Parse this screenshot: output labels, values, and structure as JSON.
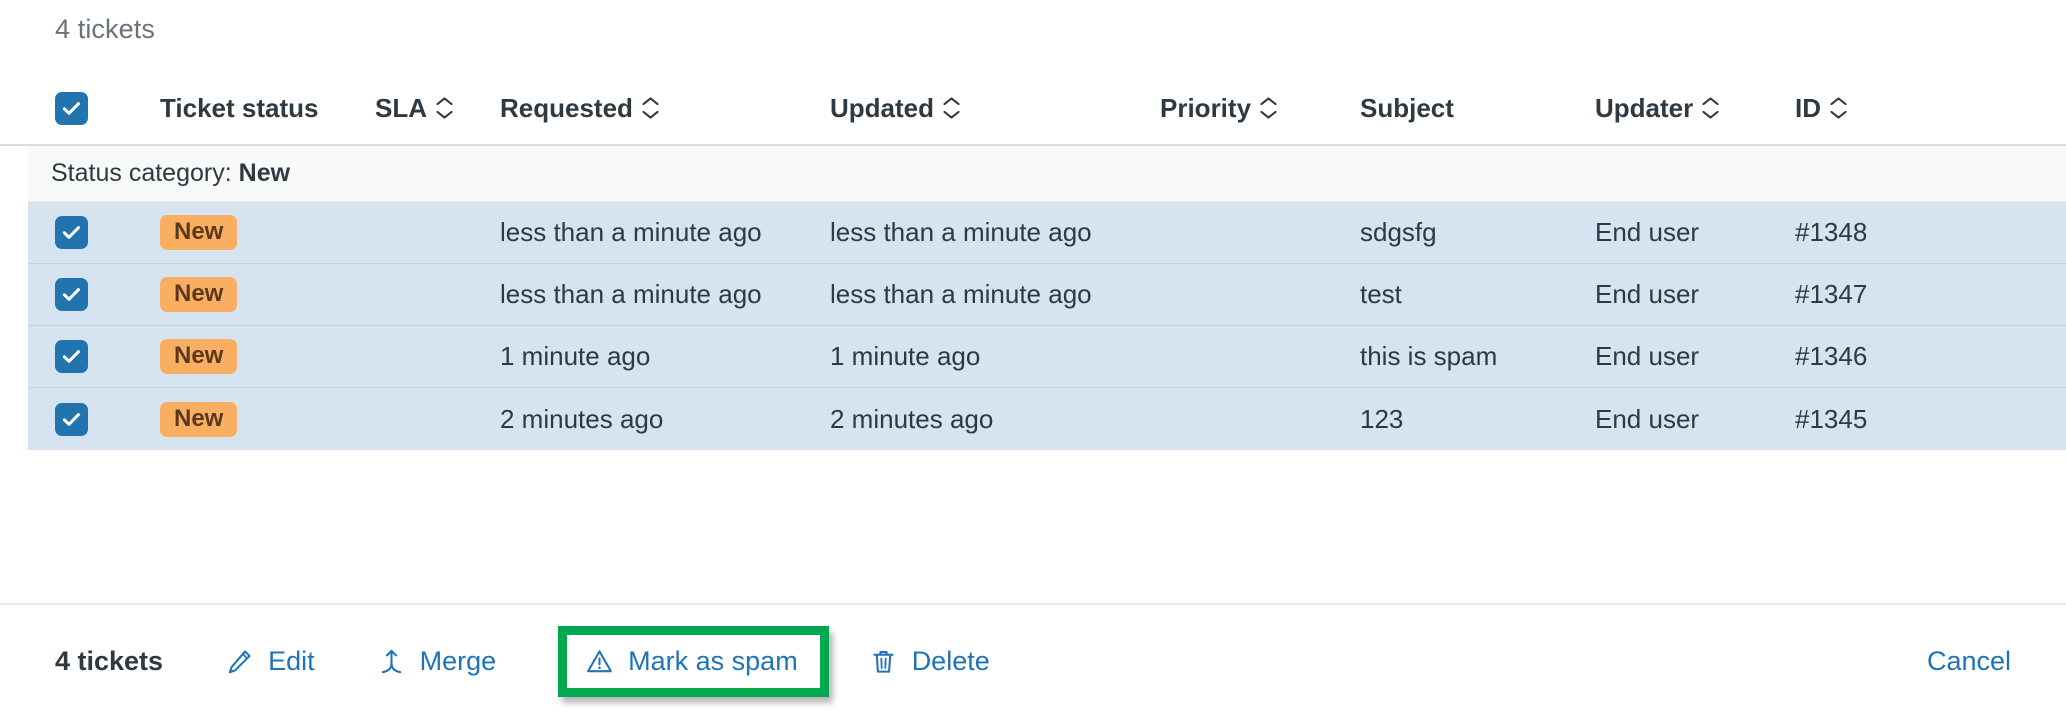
{
  "list": {
    "count_label": "4 tickets"
  },
  "table": {
    "select_all_checked": true,
    "columns": [
      {
        "key": "checkbox",
        "label": "",
        "sortable": false
      },
      {
        "key": "ticket_status",
        "label": "Ticket status",
        "sortable": false
      },
      {
        "key": "sla",
        "label": "SLA",
        "sortable": true
      },
      {
        "key": "requested",
        "label": "Requested",
        "sortable": true
      },
      {
        "key": "updated",
        "label": "Updated",
        "sortable": true
      },
      {
        "key": "priority",
        "label": "Priority",
        "sortable": true
      },
      {
        "key": "subject",
        "label": "Subject",
        "sortable": false
      },
      {
        "key": "updater",
        "label": "Updater",
        "sortable": true
      },
      {
        "key": "id",
        "label": "ID",
        "sortable": true
      }
    ],
    "group": {
      "prefix": "Status category:",
      "value": "New"
    },
    "rows": [
      {
        "checked": true,
        "status": "New",
        "sla": "",
        "requested": "less than a minute ago",
        "updated": "less than a minute ago",
        "priority": "",
        "subject": "sdgsfg",
        "updater": "End user",
        "id": "#1348"
      },
      {
        "checked": true,
        "status": "New",
        "sla": "",
        "requested": "less than a minute ago",
        "updated": "less than a minute ago",
        "priority": "",
        "subject": "test",
        "updater": "End user",
        "id": "#1347"
      },
      {
        "checked": true,
        "status": "New",
        "sla": "",
        "requested": "1 minute ago",
        "updated": "1 minute ago",
        "priority": "",
        "subject": "this is spam",
        "updater": "End user",
        "id": "#1346"
      },
      {
        "checked": true,
        "status": "New",
        "sla": "",
        "requested": "2 minutes ago",
        "updated": "2 minutes ago",
        "priority": "",
        "subject": "123",
        "updater": "End user",
        "id": "#1345"
      }
    ]
  },
  "footer": {
    "selection_count": "4 tickets",
    "actions": [
      {
        "key": "edit",
        "label": "Edit",
        "icon": "pencil-icon"
      },
      {
        "key": "merge",
        "label": "Merge",
        "icon": "merge-icon"
      },
      {
        "key": "mark_as_spam",
        "label": "Mark as spam",
        "icon": "warning-triangle-icon",
        "highlighted": true
      },
      {
        "key": "delete",
        "label": "Delete",
        "icon": "trash-icon"
      }
    ],
    "cancel_label": "Cancel"
  },
  "colors": {
    "accent_blue": "#1f73b7",
    "checkbox_blue": "#2274ae",
    "badge_orange": "#faae62",
    "badge_text": "#5b3a1c",
    "row_selected": "#d6e3f0",
    "group_bg": "#f8f9f9",
    "text_primary": "#2f3941",
    "text_muted": "#68737d",
    "highlight_green": "#00a94f"
  }
}
